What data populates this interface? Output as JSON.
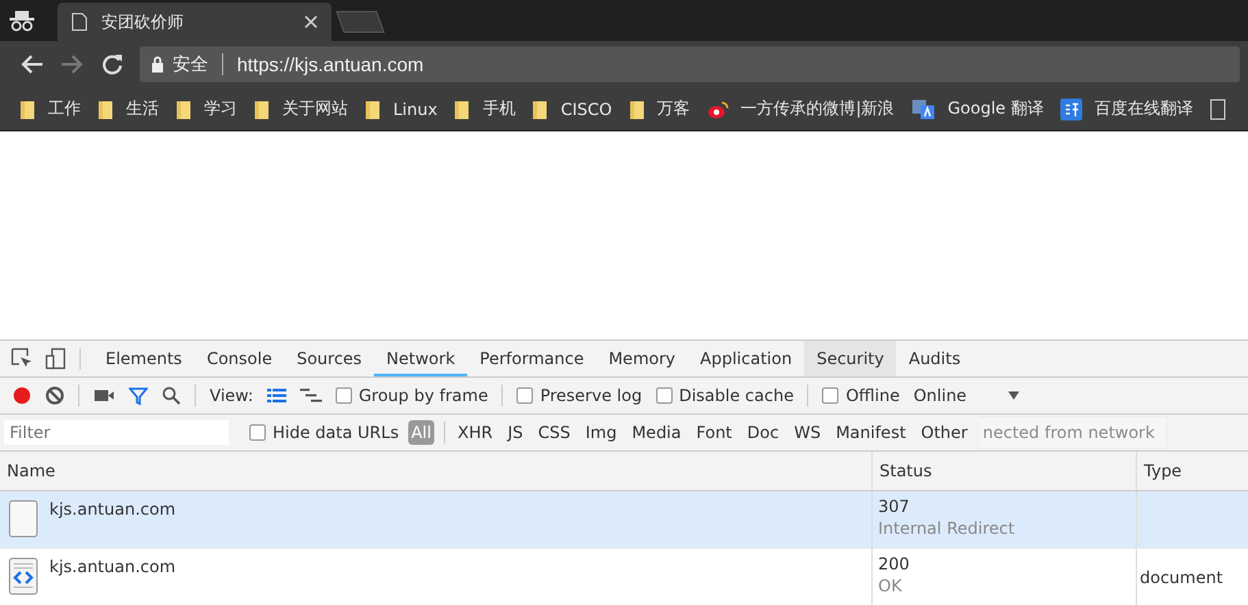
{
  "browser": {
    "tab": {
      "title": "安团砍价师"
    },
    "address": {
      "security": "安全",
      "url": "https://kjs.antuan.com"
    },
    "bookmarks": [
      {
        "kind": "folder",
        "label": "工作"
      },
      {
        "kind": "folder",
        "label": "生活"
      },
      {
        "kind": "folder",
        "label": "学习"
      },
      {
        "kind": "folder",
        "label": "关于网站"
      },
      {
        "kind": "folder",
        "label": "Linux"
      },
      {
        "kind": "folder",
        "label": "手机"
      },
      {
        "kind": "folder",
        "label": "CISCO"
      },
      {
        "kind": "folder",
        "label": "万客"
      },
      {
        "kind": "weibo",
        "label": "一方传承的微博|新浪"
      },
      {
        "kind": "translate",
        "label": "Google 翻译"
      },
      {
        "kind": "yi",
        "label": "百度在线翻译"
      },
      {
        "kind": "page"
      }
    ]
  },
  "devtools": {
    "tabs": [
      {
        "label": "Elements",
        "selected": false
      },
      {
        "label": "Console",
        "selected": false
      },
      {
        "label": "Sources",
        "selected": false
      },
      {
        "label": "Network",
        "selected": true
      },
      {
        "label": "Performance",
        "selected": false
      },
      {
        "label": "Memory",
        "selected": false
      },
      {
        "label": "Application",
        "selected": false
      },
      {
        "label": "Security",
        "selected": false,
        "hovered": true
      },
      {
        "label": "Audits",
        "selected": false
      }
    ],
    "toolbar": {
      "recording": true,
      "view_label": "View:",
      "group_by_frame": {
        "label": "Group by frame",
        "checked": false
      },
      "preserve_log": {
        "label": "Preserve log",
        "checked": false
      },
      "disable_cache": {
        "label": "Disable cache",
        "checked": false
      },
      "offline": {
        "label": "Offline",
        "checked": false
      },
      "throttle": "Online"
    },
    "filter": {
      "placeholder": "Filter",
      "hide_data_urls": {
        "label": "Hide data URLs",
        "checked": false
      },
      "types": [
        {
          "label": "All",
          "selected": true
        },
        {
          "label": "XHR",
          "selected": false
        },
        {
          "label": "JS",
          "selected": false
        },
        {
          "label": "CSS",
          "selected": false
        },
        {
          "label": "Img",
          "selected": false
        },
        {
          "label": "Media",
          "selected": false
        },
        {
          "label": "Font",
          "selected": false
        },
        {
          "label": "Doc",
          "selected": false
        },
        {
          "label": "WS",
          "selected": false
        },
        {
          "label": "Manifest",
          "selected": false
        },
        {
          "label": "Other",
          "selected": false
        }
      ],
      "tooltip": "nected from network"
    },
    "table": {
      "columns": [
        "Name",
        "Status",
        "Type"
      ],
      "rows": [
        {
          "kind": "blank",
          "name": "kjs.antuan.com",
          "status": "307",
          "status_text": "Internal Redirect",
          "selected": true
        },
        {
          "kind": "document",
          "name": "kjs.antuan.com",
          "status": "200",
          "status_text": "OK",
          "type": "document",
          "selected": false
        }
      ]
    }
  }
}
